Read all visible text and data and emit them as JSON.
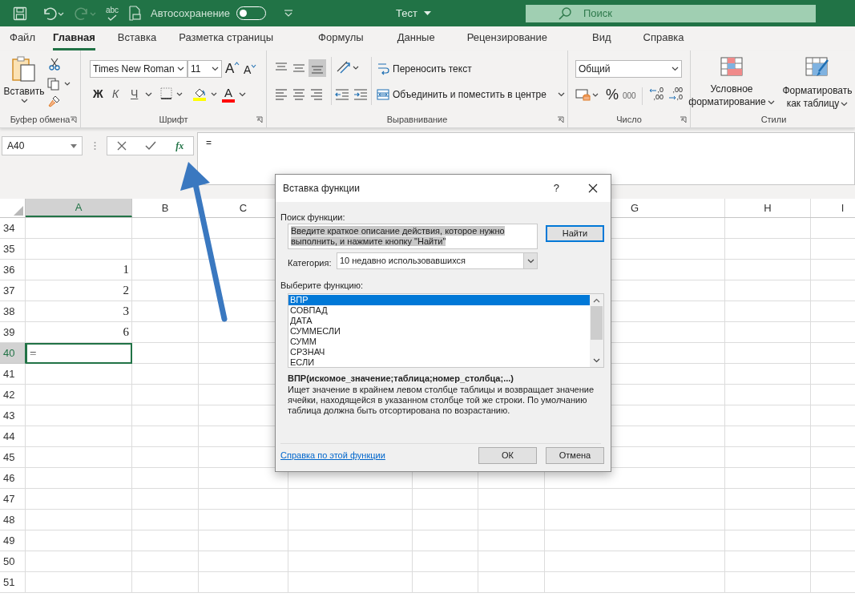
{
  "title_bar": {
    "spelling_icon_text": "abc",
    "autosave_label": "Автосохранение",
    "autosave_on": false,
    "file_title": "Тест",
    "search_placeholder": "Поиск"
  },
  "tabs": [
    {
      "label": "Файл",
      "selected": false
    },
    {
      "label": "Главная",
      "selected": true
    },
    {
      "label": "Вставка",
      "selected": false
    },
    {
      "label": "Разметка страницы",
      "selected": false
    },
    {
      "label": "Формулы",
      "selected": false
    },
    {
      "label": "Данные",
      "selected": false
    },
    {
      "label": "Рецензирование",
      "selected": false
    },
    {
      "label": "Вид",
      "selected": false
    },
    {
      "label": "Справка",
      "selected": false
    }
  ],
  "ribbon": {
    "clipboard": {
      "paste": "Вставить",
      "label": "Буфер обмена"
    },
    "font": {
      "font_name": "Times New Roman",
      "font_size": "11",
      "grow": "A",
      "shrink": "A",
      "bold": "Ж",
      "italic": "К",
      "underline": "Ч",
      "font_color": "A",
      "label": "Шрифт"
    },
    "alignment": {
      "wrap_text": "Переносить текст",
      "merge_center": "Объединить и поместить в центре",
      "label": "Выравнивание"
    },
    "number": {
      "format": "Общий",
      "percent": "%",
      "thousands": "000",
      "increase_decimal": [
        ",0",
        ",00"
      ],
      "decrease_decimal": [
        ",00",
        ",0"
      ],
      "label": "Число"
    },
    "styles": {
      "conditional_formatting": "Условное форматирование",
      "format_as_table": "Форматировать как таблицу",
      "label": "Стили"
    }
  },
  "formula_bar": {
    "name_box": "A40",
    "function_button": "fx",
    "formula": "="
  },
  "sheet": {
    "columns": [
      {
        "label": "A",
        "selected": true
      },
      {
        "label": "B",
        "selected": false
      },
      {
        "label": "C",
        "selected": false
      },
      {
        "label": "G",
        "selected": false
      },
      {
        "label": "H",
        "selected": false
      },
      {
        "label": "I",
        "selected": false
      }
    ],
    "rows": [
      {
        "number": "34",
        "a": "",
        "selected": false
      },
      {
        "number": "35",
        "a": "",
        "selected": false
      },
      {
        "number": "36",
        "a": "1",
        "selected": false
      },
      {
        "number": "37",
        "a": "2",
        "selected": false
      },
      {
        "number": "38",
        "a": "3",
        "selected": false
      },
      {
        "number": "39",
        "a": "6",
        "selected": false
      },
      {
        "number": "40",
        "a": "=",
        "selected": true
      },
      {
        "number": "41",
        "a": "",
        "selected": false
      },
      {
        "number": "42",
        "a": "",
        "selected": false
      },
      {
        "number": "43",
        "a": "",
        "selected": false
      },
      {
        "number": "44",
        "a": "",
        "selected": false
      },
      {
        "number": "45",
        "a": "",
        "selected": false
      },
      {
        "number": "46",
        "a": "",
        "selected": false
      },
      {
        "number": "47",
        "a": "",
        "selected": false
      },
      {
        "number": "48",
        "a": "",
        "selected": false
      },
      {
        "number": "49",
        "a": "",
        "selected": false
      },
      {
        "number": "50",
        "a": "",
        "selected": false
      },
      {
        "number": "51",
        "a": "",
        "selected": false
      }
    ]
  },
  "dialog": {
    "title": "Вставка функции",
    "help": "?",
    "search_label": "Поиск функции:",
    "search_value": "Введите краткое описание действия, которое нужно выполнить, и нажмите кнопку \"Найти\"",
    "find_button": "Найти",
    "category_label": "Категория:",
    "category_value": "10 недавно использовавшихся",
    "list_label": "Выберите функцию:",
    "functions": [
      {
        "name": "ВПР",
        "selected": true
      },
      {
        "name": "СОВПАД",
        "selected": false
      },
      {
        "name": "ДАТА",
        "selected": false
      },
      {
        "name": "СУММЕСЛИ",
        "selected": false
      },
      {
        "name": "СУММ",
        "selected": false
      },
      {
        "name": "СРЗНАЧ",
        "selected": false
      },
      {
        "name": "ЕСЛИ",
        "selected": false
      }
    ],
    "syntax": "ВПР(искомое_значение;таблица;номер_столбца;...)",
    "description": "Ищет значение в крайнем левом столбце таблицы и возвращает значение ячейки, находящейся в указанном столбце той же строки. По умолчанию таблица должна быть отсортирована по возрастанию.",
    "help_link": "Справка по этой функции",
    "ok_button": "ОК",
    "cancel_button": "Отмена"
  }
}
